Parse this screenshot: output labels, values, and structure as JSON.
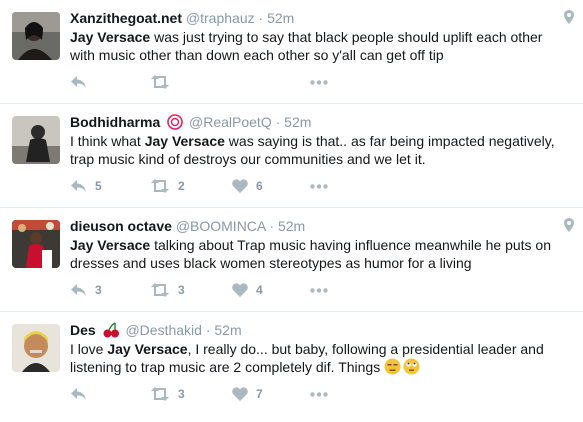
{
  "tweets": [
    {
      "name": "Xanzithegoat.net",
      "handle": "@traphauz",
      "sep": "·",
      "time": "52m",
      "mention": "Jay Versace",
      "text_before": "",
      "text_after": " was just trying to say that black people should uplift each other with music other than down each other so y'all can get off tip",
      "reply_count": "",
      "retweet_count": "",
      "like_count": "",
      "has_location": true
    },
    {
      "name": "Bodhidharma",
      "handle": "@RealPoetQ",
      "sep": "·",
      "time": "52m",
      "mention": "Jay Versace",
      "text_before": "I think what ",
      "text_after": " was saying is that.. as far being impacted negatively, trap music kind of destroys our communities and we let it.",
      "reply_count": "5",
      "retweet_count": "2",
      "like_count": "6",
      "has_location": false
    },
    {
      "name": "dieuson octave",
      "handle": "@BOOMINCA",
      "sep": "·",
      "time": "52m",
      "mention": "Jay Versace",
      "text_before": "",
      "text_after": " talking about Trap music having influence meanwhile he puts on dresses and uses black women stereotypes as humor for a living",
      "reply_count": "3",
      "retweet_count": "3",
      "like_count": "4",
      "has_location": true
    },
    {
      "name": "Des",
      "handle": "@Desthakid",
      "sep": "·",
      "time": "52m",
      "mention": "Jay Versace",
      "text_before": "I love ",
      "text_after": ", I really do... but baby, following a presidential leader and listening to trap music are 2 completely dif. Things ",
      "reply_count": "",
      "retweet_count": "3",
      "like_count": "7",
      "has_location": false
    }
  ],
  "icons": {
    "reply": "reply-icon",
    "retweet": "retweet-icon",
    "like": "heart-icon",
    "more": "more-icon",
    "location": "location-pin-icon",
    "badge": "badge-icon",
    "cherries": "cherries-icon",
    "emoji": [
      "unamused-face-icon",
      "rolling-eyes-face-icon"
    ]
  },
  "colors": {
    "name": "#14171a",
    "meta": "#8899a6",
    "divider": "#e6ecf0",
    "icon": "#aab8c2"
  }
}
